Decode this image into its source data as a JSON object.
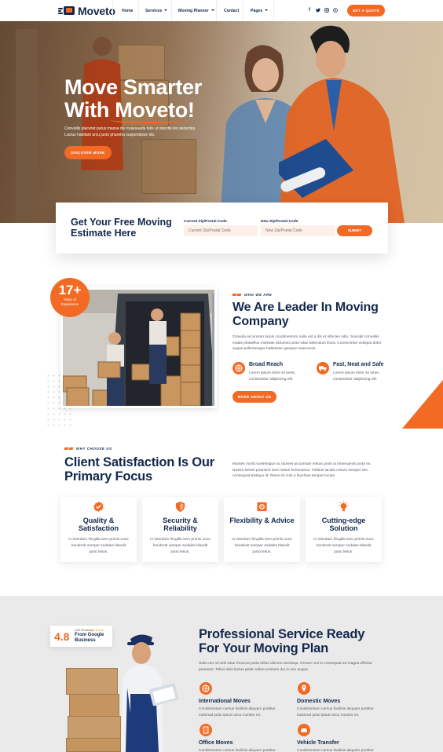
{
  "brand": {
    "name": "Moveto"
  },
  "nav": {
    "items": [
      {
        "label": "Home",
        "dropdown": false
      },
      {
        "label": "Services",
        "dropdown": true
      },
      {
        "label": "Moving Planner",
        "dropdown": true
      },
      {
        "label": "Contact",
        "dropdown": false
      },
      {
        "label": "Pages",
        "dropdown": true
      }
    ],
    "social": [
      "facebook-icon",
      "twitter-icon",
      "instagram-icon",
      "whatsapp-icon"
    ],
    "cta": "GET A QUOTE"
  },
  "hero": {
    "title_line1": "Move Smarter",
    "title_line2": "With Moveto!",
    "description": "Convallis placerat purus massa dui malesuada felis ut lobortis leo senectus. Luctus habitant arcu justo pharetra suspendisse dis.",
    "button": "DISCOVER MORE"
  },
  "estimate": {
    "title": "Get Your Free Moving Estimate Here",
    "current_label": "Current Zip/Postal Code",
    "current_placeholder": "Current Zip/Postal Code",
    "new_label": "New Zip/Postal Code",
    "new_placeholder": "New Zip/Postal Code",
    "submit": "SUBMIT"
  },
  "about": {
    "badge_number": "17+",
    "badge_label": "Years of Experience",
    "tag": "WHO WE ARE",
    "title": "We Are Leader In Moving Company",
    "description": "Gravida accumsan turpis condimentum nulla est a dis et ultricies odio. Suscipit convallis mattis phasellus molestie dictumst porta vitae bibendum litora. Consectetur volutpat dolor augue pellentesque habitasse quisque maecenas.",
    "features": [
      {
        "icon": "globe-icon",
        "title": "Broad Reach",
        "text": "Lorem ipsum dolor sit amet, consectetur adipiscing elit."
      },
      {
        "icon": "truck-icon",
        "title": "Fast, Neat and Safe",
        "text": "Lorem ipsum dolor sit amet, consectetur adipiscing elit."
      }
    ],
    "button": "MORE ABOUT US"
  },
  "why": {
    "tag": "WHY CHOOSE US",
    "title": "Client Satisfaction Is Our Primary Focus",
    "description": "Montes morbi scelerisque ac laoreet accumsan metus proin ut himenaeos porta ex. Nostra fames praesent sem metus himenaeos. Finibus iaculis rutrum semper nec consequat tristique id. Risus sit cras a faucibus tempor luctus.",
    "cards": [
      {
        "icon": "badge-check-icon",
        "title": "Quality & Satisfaction",
        "text": "In interdum fringilla sem primis nunc hendrerit semper sodales blandit justo letius."
      },
      {
        "icon": "shield-icon",
        "title": "Security & Reliability",
        "text": "In interdum fringilla sem primis nunc hendrerit semper sodales blandit justo letius."
      },
      {
        "icon": "gear-icon",
        "title": "Flexibility & Advice",
        "text": "In interdum fringilla sem primis nunc hendrerit semper sodales blandit justo letius."
      },
      {
        "icon": "lightbulb-icon",
        "title": "Cutting-edge Solution",
        "text": "In interdum fringilla sem primis nunc hendrerit semper sodales blandit justo letius."
      }
    ]
  },
  "service": {
    "rating": "4.8",
    "reviews": "(120 Reviews)",
    "rating_source": "From Google Business",
    "title": "Professional Service Ready For Your Moving Plan",
    "description": "Nulla nec id velit vitae rhoncus porta tellus ultrices sociosqu. Ornare orci in consequat ad magna efficitur praesent. Tellus duis lectus pede nullam pretium dui in nec augue.",
    "items": [
      {
        "icon": "globe-icon",
        "title": "International Moves",
        "text": "Condimentum cursus facilisis aliquam porttitor euismod justo ipsum arcu montes mi."
      },
      {
        "icon": "location-pin-icon",
        "title": "Domestic Moves",
        "text": "Condimentum cursus facilisis aliquam porttitor euismod justo ipsum arcu montes mi."
      },
      {
        "icon": "building-icon",
        "title": "Office Moves",
        "text": "Condimentum cursus facilisis aliquam porttitor"
      },
      {
        "icon": "car-icon",
        "title": "Vehicle Transfer",
        "text": "Condimentum cursus facilisis aliquam porttitor"
      }
    ]
  },
  "colors": {
    "accent": "#f26a24",
    "navy": "#13274c",
    "grey_bg": "#eaeaea"
  }
}
